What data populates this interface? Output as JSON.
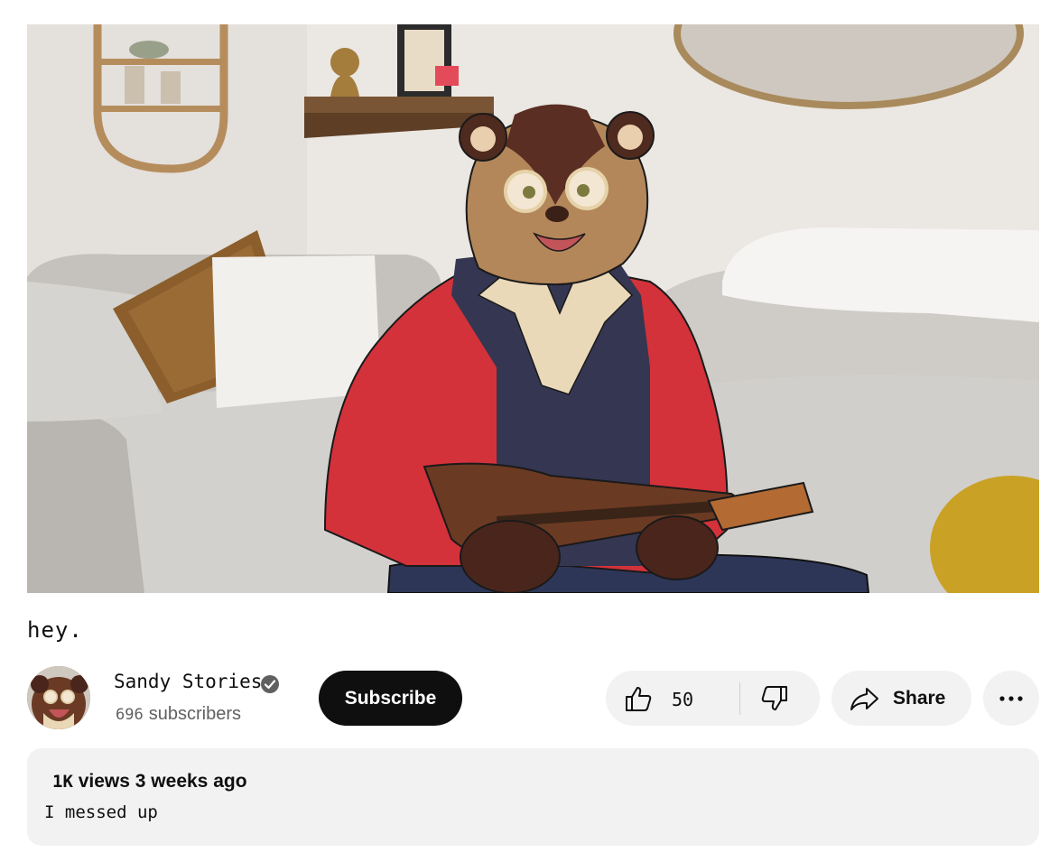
{
  "video": {
    "title": "hey."
  },
  "channel": {
    "name": "Sandy Stories",
    "subscriber_count": "696",
    "subscriber_label": "subscribers",
    "subscribe_label": "Subscribe"
  },
  "actions": {
    "like_count": "50",
    "share_label": "Share"
  },
  "description": {
    "views_count": "1K",
    "views_label": "views",
    "date": "3 weeks ago",
    "text": "I messed up"
  },
  "icons": {
    "verified": "verified-check-icon",
    "like": "thumbs-up-icon",
    "dislike": "thumbs-down-icon",
    "share": "share-arrow-icon",
    "more": "more-horizontal-icon"
  },
  "colors": {
    "subscribe_bg": "#0f0f0f",
    "pill_bg": "#f2f2f2",
    "secondary_text": "#606060",
    "jacket": "#d3323a",
    "fur": "#b3875a"
  }
}
